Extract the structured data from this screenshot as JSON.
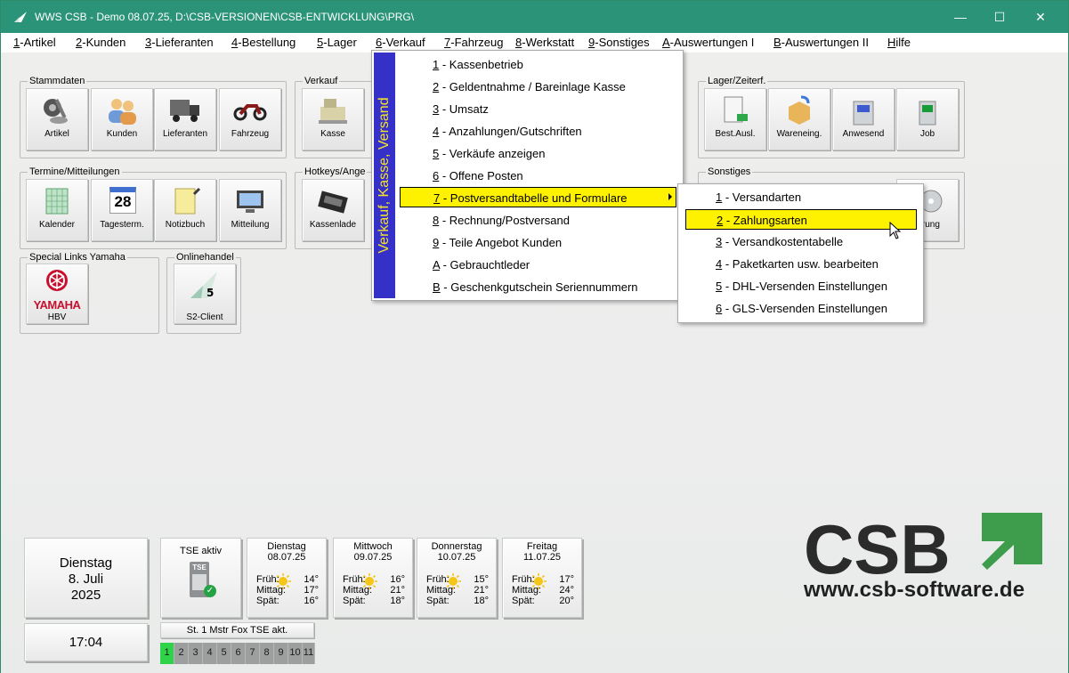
{
  "window": {
    "title": "WWS CSB - Demo  08.07.25, D:\\CSB-VERSIONEN\\CSB-ENTWICKLUNG\\PRG\\",
    "minimize": "—",
    "maximize": "☐",
    "close": "✕"
  },
  "menubar": [
    {
      "key": "1",
      "label": "-Artikel"
    },
    {
      "key": "2",
      "label": "-Kunden"
    },
    {
      "key": "3",
      "label": "-Lieferanten"
    },
    {
      "key": "4",
      "label": "-Bestellung"
    },
    {
      "key": "5",
      "label": "-Lager"
    },
    {
      "key": "6",
      "label": "-Verkauf"
    },
    {
      "key": "7",
      "label": "-Fahrzeug"
    },
    {
      "key": "8",
      "label": "-Werkstatt"
    },
    {
      "key": "9",
      "label": "-Sonstiges"
    },
    {
      "key": "A",
      "label": "-Auswertungen I"
    },
    {
      "key": "B",
      "label": "-Auswertungen II"
    },
    {
      "key": "H",
      "label": "ilfe"
    }
  ],
  "groups": {
    "stammdaten": {
      "legend": "Stammdaten",
      "tiles": [
        "Artikel",
        "Kunden",
        "Lieferanten",
        "Fahrzeug"
      ]
    },
    "verkauf": {
      "legend": "Verkauf",
      "tiles": [
        "Kasse"
      ]
    },
    "lager": {
      "legend": "Lager/Zeiterf.",
      "tiles": [
        "Best.Ausl.",
        "Wareneing.",
        "Anwesend",
        "Job"
      ]
    },
    "termine": {
      "legend": "Termine/Mitteilungen",
      "tiles": [
        "Kalender",
        "Tagesterm.",
        "Notizbuch",
        "Mitteilung"
      ]
    },
    "hotkeys": {
      "legend": "Hotkeys/Ange",
      "tiles": [
        "Kassenlade"
      ]
    },
    "sonstiges": {
      "legend": "Sonstiges",
      "tiles": [
        "ierung"
      ]
    },
    "yamaha": {
      "legend": "Special Links Yamaha",
      "tiles": [
        "HBV"
      ],
      "logo_text": "YAMAHA"
    },
    "online": {
      "legend": "Onlinehandel",
      "tiles": [
        "S2-Client"
      ]
    }
  },
  "calendar_tile_number": "28",
  "dropdown": {
    "side_label": "Verkauf, Kasse, Versand",
    "items": [
      {
        "key": "1",
        "label": " - Kassenbetrieb"
      },
      {
        "key": "2",
        "label": " - Geldentnahme / Bareinlage Kasse"
      },
      {
        "key": "3",
        "label": " - Umsatz"
      },
      {
        "key": "4",
        "label": " - Anzahlungen/Gutschriften"
      },
      {
        "key": "5",
        "label": " - Verkäufe anzeigen"
      },
      {
        "key": "6",
        "label": " - Offene Posten"
      },
      {
        "key": "7",
        "label": " - Postversandtabelle und Formulare"
      },
      {
        "key": "8",
        "label": " - Rechnung/Postversand"
      },
      {
        "key": "9",
        "label": " - Teile Angebot Kunden"
      },
      {
        "key": "A",
        "label": " - Gebrauchtleder"
      },
      {
        "key": "B",
        "label": " - Geschenkgutschein Seriennummern"
      }
    ],
    "highlighted_index": 6
  },
  "submenu": {
    "items": [
      {
        "key": "1",
        "label": " - Versandarten"
      },
      {
        "key": "2",
        "label": " - Zahlungsarten"
      },
      {
        "key": "3",
        "label": " - Versandkostentabelle"
      },
      {
        "key": "4",
        "label": " - Paketkarten usw. bearbeiten"
      },
      {
        "key": "5",
        "label": " - DHL-Versenden Einstellungen"
      },
      {
        "key": "6",
        "label": " - GLS-Versenden Einstellungen"
      }
    ],
    "highlighted_index": 1
  },
  "date_panel": {
    "weekday": "Dienstag",
    "day_month": "8. Juli",
    "year": "2025"
  },
  "time_panel": {
    "time": "17:04"
  },
  "tse_panel": {
    "label": "TSE aktiv",
    "badge": "TSE"
  },
  "weather": {
    "labels": {
      "frueh": "Früh:",
      "mittag": "Mittag:",
      "spaet": "Spät:"
    },
    "days": [
      {
        "day": "Dienstag",
        "date": "08.07.25",
        "frueh": "14°",
        "mittag": "17°",
        "spaet": "16°"
      },
      {
        "day": "Mittwoch",
        "date": "09.07.25",
        "frueh": "16°",
        "mittag": "21°",
        "spaet": "18°"
      },
      {
        "day": "Donnerstag",
        "date": "10.07.25",
        "frueh": "15°",
        "mittag": "21°",
        "spaet": "18°"
      },
      {
        "day": "Freitag",
        "date": "11.07.25",
        "frueh": "17°",
        "mittag": "24°",
        "spaet": "20°"
      }
    ]
  },
  "station": {
    "label": "St. 1 Mstr Fox TSE akt."
  },
  "slots": [
    "1",
    "2",
    "3",
    "4",
    "5",
    "6",
    "7",
    "8",
    "9",
    "10",
    "11"
  ],
  "active_slot": "1",
  "logo": {
    "brand": "CSB",
    "url": "www.csb-software.de"
  },
  "colors": {
    "titlebar": "#2b9478",
    "menu_highlight": "#fff200",
    "side_bar": "#3430c8",
    "side_text": "#f6e32b",
    "slot_active": "#2fd34a",
    "logo_green": "#3e9c4d"
  }
}
